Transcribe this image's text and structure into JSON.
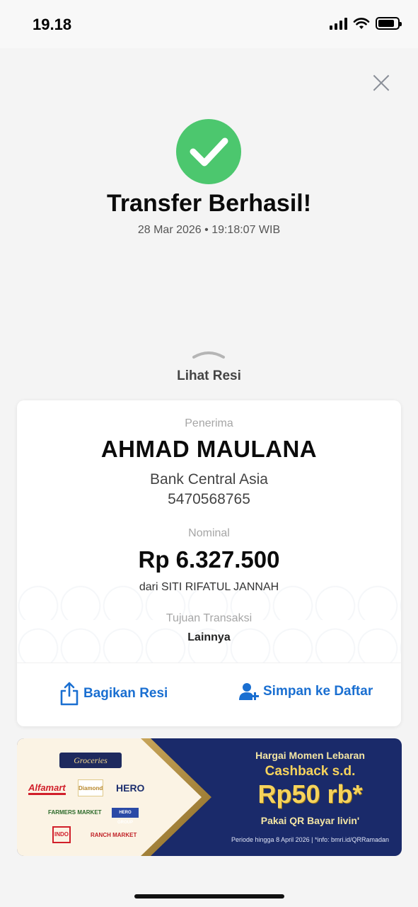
{
  "status_bar": {
    "time": "19.18"
  },
  "result": {
    "title": "Transfer Berhasil!",
    "datetime": "28 Mar 2026 • 19:18:07 WIB"
  },
  "receipt_toggle": {
    "label": "Lihat Resi"
  },
  "receipt": {
    "recipient_label": "Penerima",
    "recipient_name": "AHMAD MAULANA",
    "bank_name": "Bank Central Asia",
    "account_number": "5470568765",
    "amount_label": "Nominal",
    "amount": "Rp 6.327.500",
    "sender": "dari SITI RIFATUL JANNAH",
    "purpose_label": "Tujuan Transaksi",
    "purpose_value": "Lainnya"
  },
  "actions": {
    "share_label": "Bagikan Resi",
    "save_label": "Simpan ke Daftar"
  },
  "banner": {
    "category": "Groceries",
    "logos": [
      "Alfamart",
      "Diamond",
      "HERO",
      "FARMERS MARKET",
      "HERO GROUP",
      "INDO",
      "RANCH MARKET"
    ],
    "headline": "Hargai Momen Lebaran",
    "cashback": "Cashback s.d.",
    "cashback_amount": "Rp50 rb*",
    "cta": "Pakai QR Bayar livin'",
    "footnote": "Periode hingga 8 April 2026  |  *info: bmri.id/QRRamadan"
  },
  "colors": {
    "success": "#4cc76e",
    "link": "#1a6fd1",
    "banner_navy": "#1a2a6a",
    "banner_gold": "#f6d35c"
  },
  "icons": {
    "close": "close-icon",
    "success": "check-circle-icon",
    "share": "share-icon",
    "save": "add-user-icon"
  }
}
